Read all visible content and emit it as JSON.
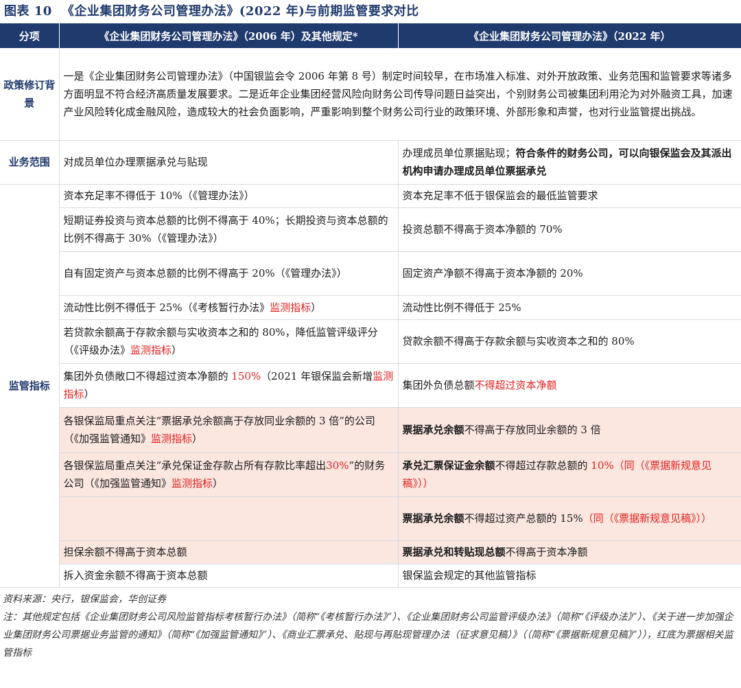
{
  "title": {
    "label": "图表 10",
    "text": "《企业集团财务公司管理办法》(2022 年)与前期监管要求对比"
  },
  "table": {
    "headers": [
      "分项",
      "《企业集团财务公司管理办法》（2006 年）及其他规定*",
      "《企业集团财务公司管理办法》（2022 年）"
    ],
    "policy": {
      "category": "政策修订背景",
      "text": "一是《企业集团财务公司管理办法》（中国银监会令 2006 年第 8 号）制定时间较早，在市场准入标准、对外开放政策、业务范围和监管要求等诸多方面明显不符合经济高质量发展要求。二是近年企业集团经营风险向财务公司传导问题日益突出，个别财务公司被集团利用沦为对外融资工具，加速产业风险转化成金融风险，造成较大的社会负面影响，严重影响到整个财务公司行业的政策环境、外部形象和声誉，也对行业监管提出挑战。"
    },
    "business": {
      "category": "业务范围",
      "old": "对成员单位办理票据承兑与贴现",
      "new_plain": "办理成员单位票据贴现；",
      "new_bold": "符合条件的财务公司，可以向银保监会及其派出机构申请办理成员单位票据承兑"
    },
    "supervision": {
      "category": "监管指标",
      "rows": [
        {
          "old": "资本充足率不得低于 10%（《管理办法》）",
          "new": "资本充足率不低于银保监会的最低监管要求"
        },
        {
          "old": "短期证券投资与资本总额的比例不得高于 40%；长期投资与资本总额的比例不得高于 30%（《管理办法》）",
          "new": "投资总额不得高于资本净额的 70%"
        },
        {
          "old": "自有固定资产与资本总额的比例不得高于 20%（《管理办法》）",
          "new": "固定资产净额不得高于资本净额的 20%"
        },
        {
          "old": "流动性比例不得低于 25%（《考核暂行办法》",
          "old_red": "监测指标",
          "old_tail": "）",
          "new": "流动性比例不得低于 25%"
        },
        {
          "old": "若贷款余额高于存款余额与实收资本之和的 80%，降低监管评级评分（《评级办法》",
          "old_red": "监测指标",
          "old_tail": "）",
          "new": "贷款余额不得高于存款余额与实收资本之和的 80%"
        },
        {
          "old_a": "集团外负债敞口不得超过资本净额的 ",
          "old_red_a": "150%",
          "old_b": "（2021 年银保监会新增",
          "old_red_b": "监测指标",
          "old_c": "）",
          "new_a": "集团外负债总额",
          "new_red": "不得超过资本净额"
        },
        {
          "old": "各银保监局重点关注“票据承兑余额高于存放同业余额的 3 倍”的公司（《加强监管通知》",
          "old_red": "监测指标",
          "old_tail": "）",
          "new_bold": "票据承兑余额",
          "new": "不得高于存放同业余额的 3 倍"
        },
        {
          "old_a": "各银保监局重点关注“承兑保证金存款占所有存款比率超出",
          "old_red_a": "30%",
          "old_b": "”的财务公司（《加强监管通知》",
          "old_red_b": "监测指标",
          "old_c": "）",
          "new_bold": "承兑汇票保证金余额",
          "new": "不得超过存款总额的 ",
          "new_red": "10%（同（《票据新规意见稿》））"
        },
        {
          "new_bold": "票据承兑余额",
          "new": "不得超过资产总额的 15%",
          "new_red": "（同（《票据新规意见稿》））"
        },
        {
          "old": "担保余额不得高于资本总额",
          "new_bold": "票据承兑和转贴现总额",
          "new": "不得高于资本净额"
        },
        {
          "old": "拆入资金余额不得高于资本总额",
          "new": "银保监会规定的其他监管指标"
        }
      ]
    }
  },
  "notes": {
    "source": "资料来源：央行，银保监会，华创证券",
    "note": "注：其他规定包括《企业集团财务公司风险监管指标考核暂行办法》（简称“《考核暂行办法》”）、《企业集团财务公司监管评级办法》（简称“《评级办法》”）、《关于进一步加强企业集团财务公司票据业务监管的通知》（简称“《加强监管通知》”）、《商业汇票承兑、贴现与再贴现管理办法（征求意见稿）》（（简称“《票据新规意见稿》”）），红底为票据相关监管指标"
  }
}
